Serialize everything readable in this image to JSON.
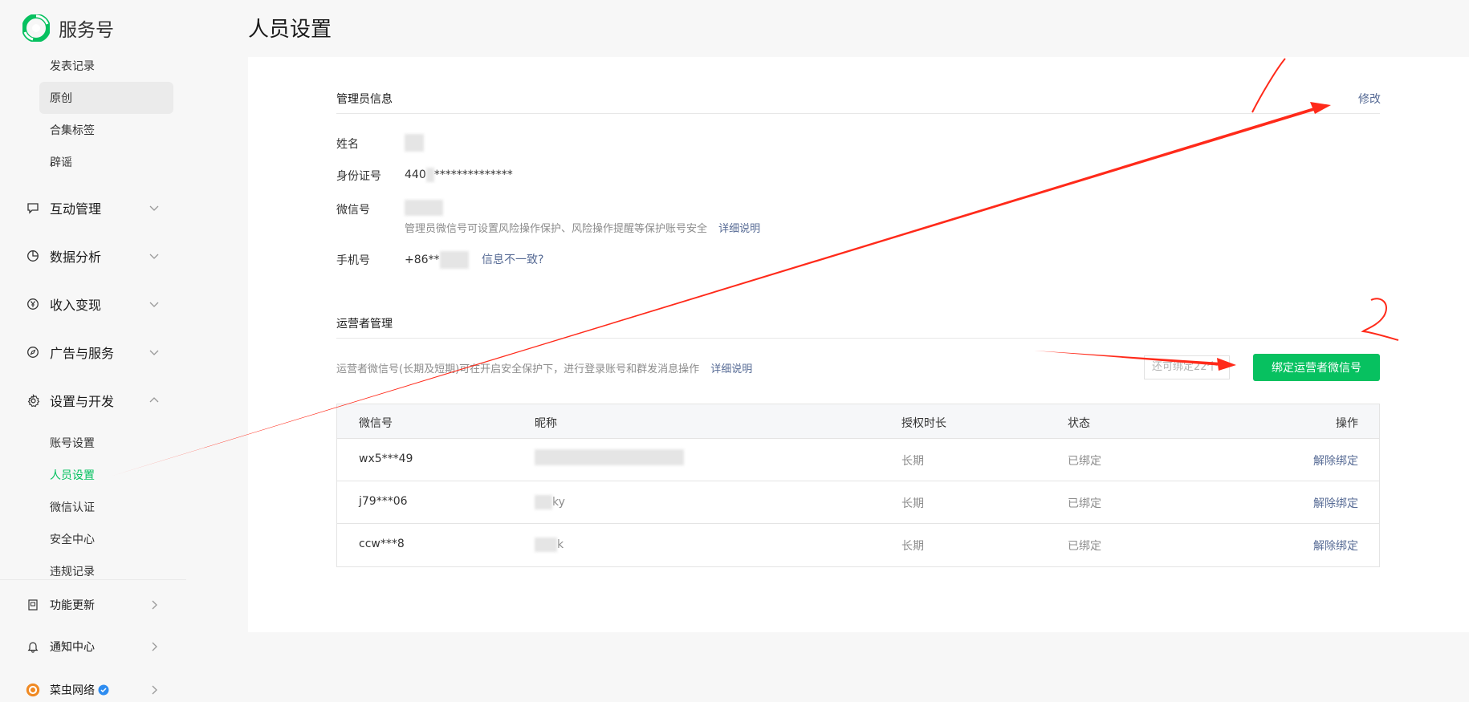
{
  "sidebar": {
    "app_name": "服务号",
    "sub_items_top": [
      {
        "label": "发表记录"
      },
      {
        "label": "原创"
      },
      {
        "label": "合集标签"
      },
      {
        "label": "辟谣"
      }
    ],
    "nav": [
      {
        "label": "互动管理",
        "icon": "chat-icon"
      },
      {
        "label": "数据分析",
        "icon": "pie-chart-icon"
      },
      {
        "label": "收入变现",
        "icon": "yen-icon"
      },
      {
        "label": "广告与服务",
        "icon": "compass-icon"
      },
      {
        "label": "设置与开发",
        "icon": "gear-icon"
      }
    ],
    "settings_sub": [
      {
        "label": "账号设置"
      },
      {
        "label": "人员设置"
      },
      {
        "label": "微信认证"
      },
      {
        "label": "安全中心"
      },
      {
        "label": "违规记录"
      }
    ],
    "bottom": [
      {
        "label": "功能更新",
        "icon": "book-icon"
      },
      {
        "label": "通知中心",
        "icon": "bell-icon"
      },
      {
        "label": "菜虫网络",
        "icon": "account-avatar-icon"
      }
    ]
  },
  "page": {
    "title": "人员设置"
  },
  "admin": {
    "section_title": "管理员信息",
    "edit_label": "修改",
    "name_label": "姓名",
    "id_label": "身份证号",
    "id_value_prefix": "440",
    "id_value_suffix": "**************",
    "wechat_label": "微信号",
    "wechat_hint": "管理员微信号可设置风险操作保护、风险操作提醒等保护账号安全",
    "wechat_hint_link": "详细说明",
    "phone_label": "手机号",
    "phone_prefix": "+86**",
    "phone_link": "信息不一致?"
  },
  "operators": {
    "section_title": "运营者管理",
    "hint": "运营者微信号(长期及短期)可在开启安全保护下，进行登录账号和群发消息操作",
    "hint_link": "详细说明",
    "remaining": "还可绑定22个",
    "bind_button": "绑定运营者微信号",
    "columns": [
      "微信号",
      "昵称",
      "授权时长",
      "状态",
      "操作"
    ],
    "rows": [
      {
        "wxid": "wx5***49",
        "nickname": "",
        "duration": "长期",
        "status": "已绑定",
        "action": "解除绑定"
      },
      {
        "wxid": "j79***06",
        "nickname": "ky",
        "duration": "长期",
        "status": "已绑定",
        "action": "解除绑定"
      },
      {
        "wxid": "ccw***8",
        "nickname": "k",
        "duration": "长期",
        "status": "已绑定",
        "action": "解除绑定"
      }
    ]
  },
  "colors": {
    "brand_green": "#07c160",
    "link_blue": "#576b95",
    "annotation_red": "#ff2a1a"
  }
}
